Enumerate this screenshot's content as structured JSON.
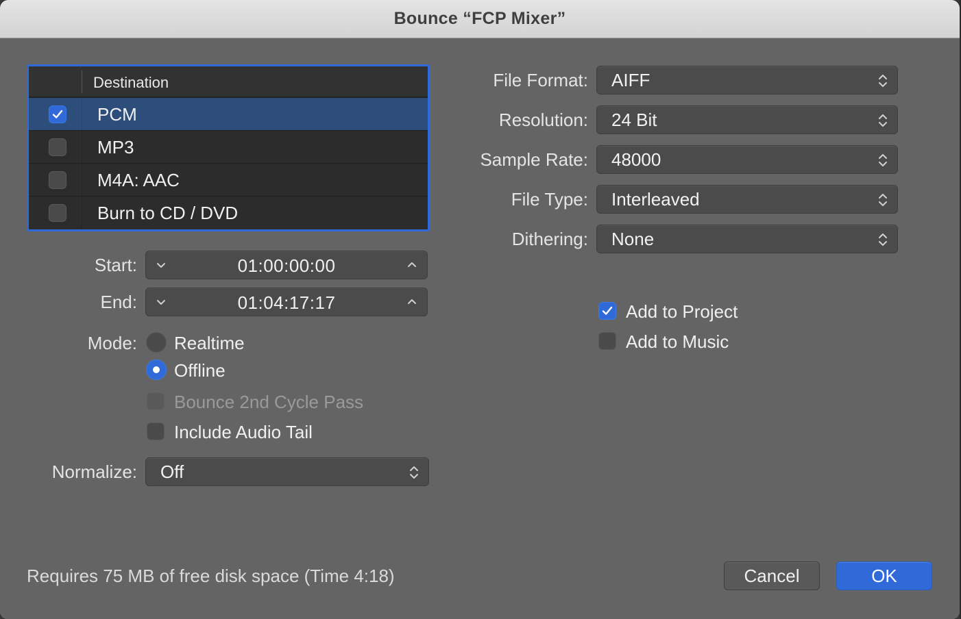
{
  "window": {
    "title": "Bounce “FCP Mixer”"
  },
  "destination": {
    "header": "Destination",
    "rows": [
      {
        "label": "PCM",
        "checked": true,
        "selected": true
      },
      {
        "label": "MP3",
        "checked": false,
        "selected": false
      },
      {
        "label": "M4A: AAC",
        "checked": false,
        "selected": false
      },
      {
        "label": "Burn to CD / DVD",
        "checked": false,
        "selected": false
      }
    ]
  },
  "range": {
    "start_label": "Start:",
    "start_value": "01:00:00:00",
    "end_label": "End:",
    "end_value": "01:04:17:17"
  },
  "mode": {
    "label": "Mode:",
    "options": [
      {
        "label": "Realtime",
        "selected": false
      },
      {
        "label": "Offline",
        "selected": true
      }
    ],
    "bounce_2nd_cycle": {
      "label": "Bounce 2nd Cycle Pass",
      "checked": false,
      "enabled": false
    },
    "include_audio_tail": {
      "label": "Include Audio Tail",
      "checked": false,
      "enabled": true
    }
  },
  "normalize": {
    "label": "Normalize:",
    "value": "Off"
  },
  "format": {
    "file_format": {
      "label": "File Format:",
      "value": "AIFF"
    },
    "resolution": {
      "label": "Resolution:",
      "value": "24 Bit"
    },
    "sample_rate": {
      "label": "Sample Rate:",
      "value": "48000"
    },
    "file_type": {
      "label": "File Type:",
      "value": "Interleaved"
    },
    "dithering": {
      "label": "Dithering:",
      "value": "None"
    }
  },
  "add_to": {
    "project": {
      "label": "Add to Project",
      "checked": true
    },
    "music": {
      "label": "Add to Music",
      "checked": false
    }
  },
  "footer": {
    "status": "Requires 75 MB of free disk space  (Time 4:18)"
  },
  "buttons": {
    "cancel": "Cancel",
    "ok": "OK"
  },
  "colors": {
    "accent": "#2f6ad8",
    "dialog_bg": "#646464",
    "selected_row": "#2d4e7b"
  }
}
